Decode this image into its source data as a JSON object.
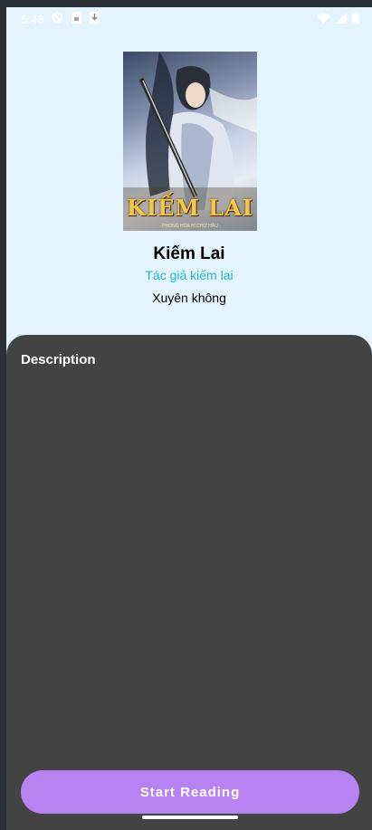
{
  "status_bar": {
    "time": "5:48",
    "left_icons": [
      "do-not-disturb-icon",
      "sim-card-icon",
      "download-icon"
    ],
    "right_icons": [
      "wifi-icon",
      "cell-signal-icon",
      "battery-icon"
    ]
  },
  "book": {
    "cover_title": "KIẾM LAI",
    "cover_subtitle": "- PHONG HỎA HÍ CHƯ HẦU -",
    "title": "Kiếm Lai",
    "author": "Tác giả kiếm lai",
    "genre": "Xuyên không"
  },
  "sheet": {
    "heading": "Description",
    "description": ""
  },
  "actions": {
    "start_label": "Start Reading"
  },
  "colors": {
    "screen_background": "#e3f4fe",
    "sheet_background": "#434343",
    "author_accent": "#22b4d6",
    "button_background": "#b882f3"
  }
}
